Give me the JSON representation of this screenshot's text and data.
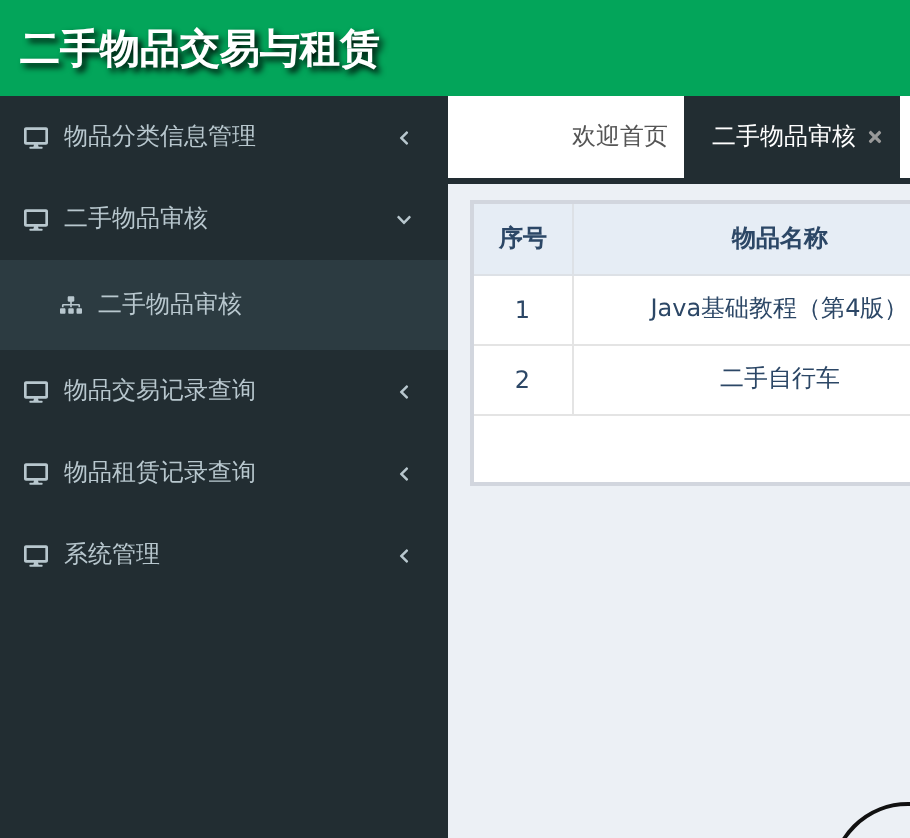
{
  "header": {
    "title": "二手物品交易与租赁"
  },
  "sidebar": {
    "items": [
      {
        "label": "物品分类信息管理",
        "expanded": false
      },
      {
        "label": "二手物品审核",
        "expanded": true,
        "children": [
          {
            "label": "二手物品审核",
            "selected": true
          }
        ]
      },
      {
        "label": "物品交易记录查询",
        "expanded": false
      },
      {
        "label": "物品租赁记录查询",
        "expanded": false
      },
      {
        "label": "系统管理",
        "expanded": false
      }
    ]
  },
  "tabs": [
    {
      "label": "欢迎首页",
      "selected": false,
      "closable": false
    },
    {
      "label": "二手物品审核",
      "selected": true,
      "closable": true
    }
  ],
  "table": {
    "columns": [
      "序号",
      "物品名称"
    ],
    "rows": [
      [
        "1",
        "Java基础教程（第4版）"
      ],
      [
        "2",
        "二手自行车"
      ]
    ]
  }
}
